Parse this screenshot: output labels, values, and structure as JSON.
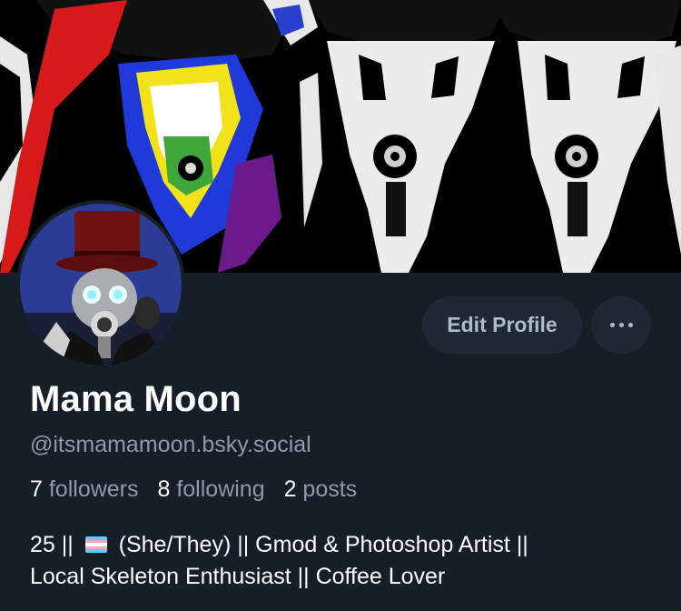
{
  "profile": {
    "display_name": "Mama Moon",
    "handle": "@itsmamamoon.bsky.social",
    "bio_line1_before_flag": "25 || ",
    "bio_flag_icon": "transgender-flag-emoji",
    "bio_line1_after_flag": " (She/They) || Gmod & Photoshop Artist ||",
    "bio_line2": "Local Skeleton Enthusiast || Coffee Lover",
    "banner_icon": "profile-banner",
    "avatar_icon": "profile-avatar"
  },
  "stats": {
    "followers_count": "7",
    "followers_label": "followers",
    "following_count": "8",
    "following_label": "following",
    "posts_count": "2",
    "posts_label": "posts"
  },
  "actions": {
    "edit_profile_label": "Edit Profile",
    "more_icon": "ellipsis-icon"
  },
  "colors": {
    "background": "#161e27",
    "button_bg": "#1e2935",
    "button_text": "#aebbc9",
    "muted_text": "#8d9aab",
    "primary_text": "#ffffff"
  }
}
